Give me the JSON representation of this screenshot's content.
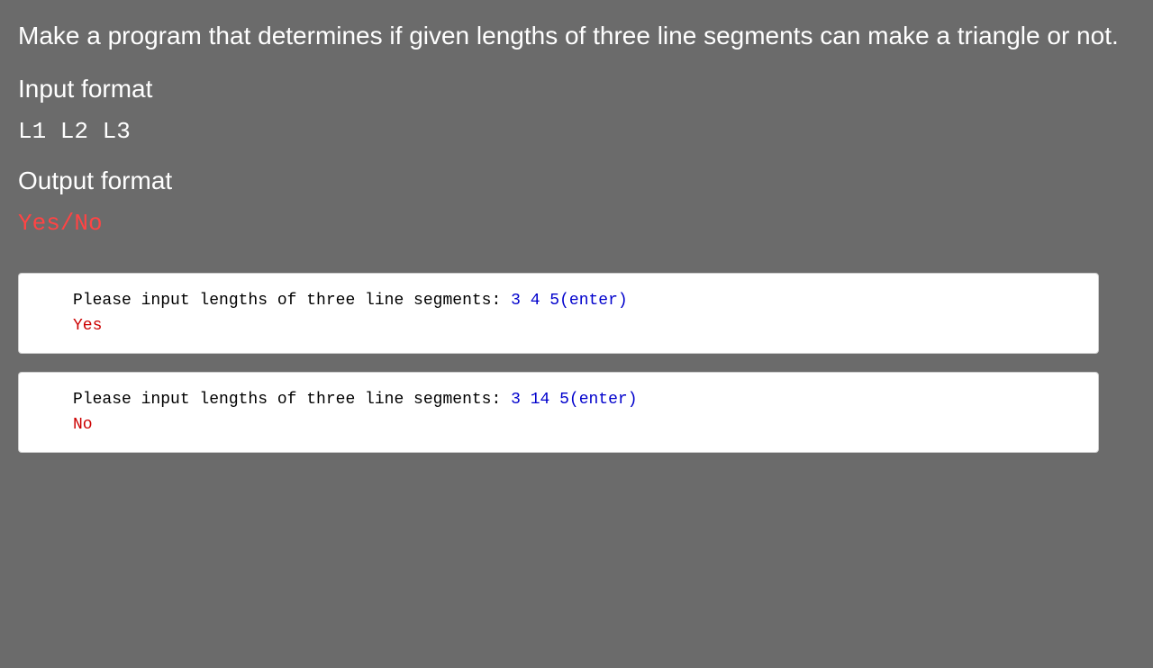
{
  "problem": {
    "description": "Make a program that determines if given lengths of three line segments can make a triangle or not.",
    "input_format_heading": "Input format",
    "input_format_line": "L1      L2      L3",
    "output_format_heading": "Output format",
    "output_format_line": "Yes/No"
  },
  "examples": [
    {
      "prompt": "Please input lengths of three line segments:  ",
      "user_input": "3 4 5(enter)",
      "output": "Yes"
    },
    {
      "prompt": "Please input lengths of three line segments:  ",
      "user_input": "3 14 5(enter)",
      "output": "No"
    }
  ]
}
